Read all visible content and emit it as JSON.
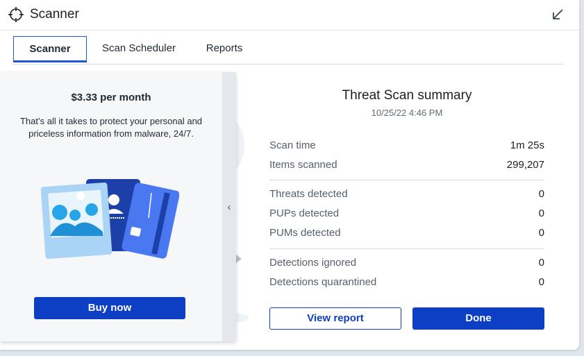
{
  "app": {
    "title": "Scanner"
  },
  "tabs": [
    {
      "label": "Scanner",
      "active": true
    },
    {
      "label": "Scan Scheduler",
      "active": false
    },
    {
      "label": "Reports",
      "active": false
    }
  ],
  "promo": {
    "price": "$3.33 per month",
    "text": "That’s all it takes to protect your personal and priceless information from malware, 24/7.",
    "buy_label": "Buy now",
    "collapse_icon": "chevron-left-icon"
  },
  "summary": {
    "title": "Threat Scan summary",
    "date": "10/25/22 4:46 PM",
    "rows": [
      {
        "label": "Scan time",
        "value": "1m 25s"
      },
      {
        "label": "Items scanned",
        "value": "299,207"
      },
      {
        "label": "Threats detected",
        "value": "0"
      },
      {
        "label": "PUPs detected",
        "value": "0"
      },
      {
        "label": "PUMs detected",
        "value": "0"
      },
      {
        "label": "Detections ignored",
        "value": "0"
      },
      {
        "label": "Detections quarantined",
        "value": "0"
      }
    ],
    "view_report_label": "View report",
    "done_label": "Done"
  },
  "colors": {
    "accent": "#0d3fc4",
    "tab_active": "#1d55d6",
    "panel_bg": "#f5f7f9"
  }
}
